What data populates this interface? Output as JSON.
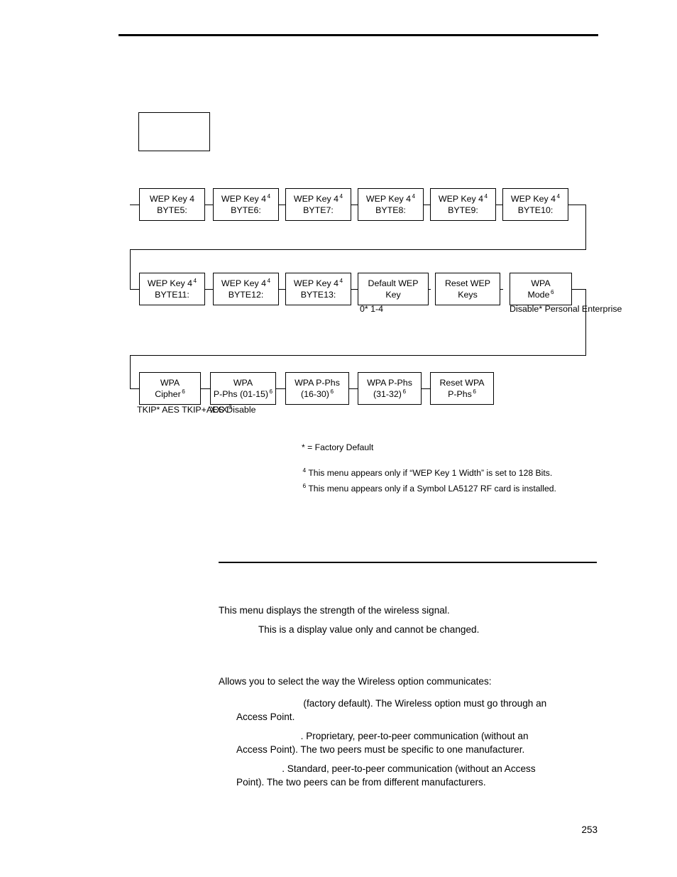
{
  "page": {
    "number": "253"
  },
  "diagram": {
    "empty_box_label": "",
    "row1": [
      {
        "line1": "WEP Key 4",
        "line2": "BYTE5:",
        "sup": ""
      },
      {
        "line1": "WEP Key 4",
        "line2": "BYTE6:",
        "sup": "4"
      },
      {
        "line1": "WEP Key 4",
        "line2": "BYTE7:",
        "sup": "4"
      },
      {
        "line1": "WEP Key 4",
        "line2": "BYTE8:",
        "sup": "4"
      },
      {
        "line1": "WEP Key 4",
        "line2": "BYTE9:",
        "sup": "4"
      },
      {
        "line1": "WEP Key 4",
        "line2": "BYTE10:",
        "sup": "4"
      }
    ],
    "row2": [
      {
        "line1": "WEP Key 4",
        "line2": "BYTE11:",
        "sup": "4"
      },
      {
        "line1": "WEP Key 4",
        "line2": "BYTE12:",
        "sup": "4"
      },
      {
        "line1": "WEP Key 4",
        "line2": "BYTE13:",
        "sup": "4"
      },
      {
        "line1": "Default WEP",
        "line2": "Key",
        "sup": ""
      },
      {
        "line1": "Reset WEP",
        "line2": "Keys",
        "sup": ""
      },
      {
        "line1": "WPA",
        "line2": "Mode",
        "sup": "6"
      }
    ],
    "row3": [
      {
        "line1": "WPA",
        "line2": "Cipher",
        "sup": "6"
      },
      {
        "line1": "WPA",
        "line2": "P-Phs (01-15)",
        "sup": "6"
      },
      {
        "line1": "WPA P-Phs",
        "line2": "(16-30)",
        "sup": "6"
      },
      {
        "line1": "WPA P-Phs",
        "line2": "(31-32)",
        "sup": "6"
      },
      {
        "line1": "Reset WPA",
        "line2": "P-Phs",
        "sup": "6"
      }
    ],
    "options": {
      "default_wep_key": "0*\n1-4",
      "wpa_mode": "Disable*\nPersonal\nEnterprise",
      "wpa_cipher": "TKIP*\nAES\nTKIP+AES\nDisable",
      "wpa_pphs": "XXX",
      "wpa_pphs_sup": "3"
    },
    "footnotes": {
      "factory_default": "* = Factory Default",
      "note4_sup": "4",
      "note4": "This menu appears only if “WEP Key 1 Width” is set to 128 Bits.",
      "note6_sup": "6",
      "note6": "This menu appears only if a Symbol LA5127 RF card is installed."
    }
  },
  "body": {
    "signal_strength_desc": "This menu displays the strength of the wireless signal.",
    "signal_strength_note": "This is a display value only and cannot be changed.",
    "comm_intro": "Allows you to select the way the Wireless option communicates:",
    "comm_item1": "                         (factory default). The Wireless option must go through an\nAccess Point.",
    "comm_item2": "                        . Proprietary, peer-to-peer communication (without an\nAccess Point). The two peers must be specific to one manufacturer.",
    "comm_item3": "                 . Standard, peer-to-peer communication (without an Access\nPoint). The two peers can be from different manufacturers."
  }
}
